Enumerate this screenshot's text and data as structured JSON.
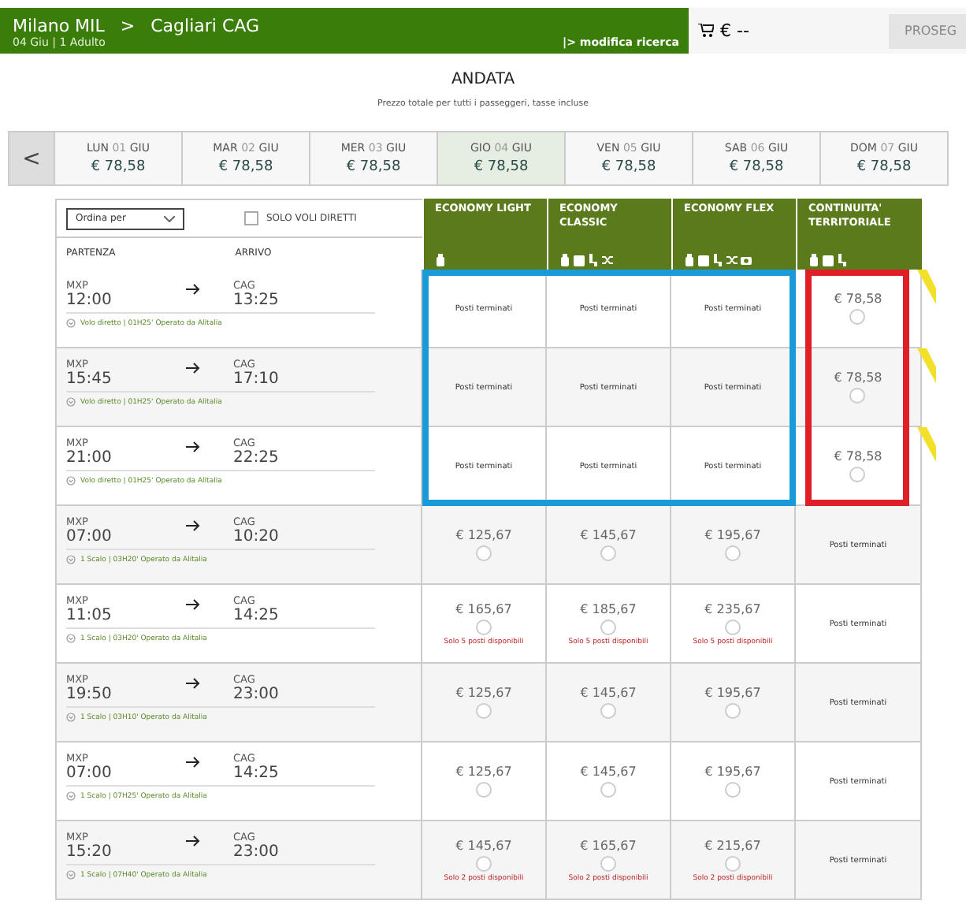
{
  "header": {
    "origin": "Milano MIL",
    "separator": ">",
    "destination": "Cagliari CAG",
    "details": "04 Giu | 1 Adulto",
    "modify_link": "|> modifica ricerca",
    "cart_total": "€ --",
    "continue_button": "PROSEG"
  },
  "title": "ANDATA",
  "subtitle": "Prezzo totale per tutti i passeggeri, tasse incluse",
  "date_strip": {
    "prev_button": "<",
    "days": [
      {
        "weekday": "LUN",
        "day": "01",
        "month": "GIU",
        "price": "€ 78,58",
        "selected": false
      },
      {
        "weekday": "MAR",
        "day": "02",
        "month": "GIU",
        "price": "€ 78,58",
        "selected": false
      },
      {
        "weekday": "MER",
        "day": "03",
        "month": "GIU",
        "price": "€ 78,58",
        "selected": false
      },
      {
        "weekday": "GIO",
        "day": "04",
        "month": "GIU",
        "price": "€ 78,58",
        "selected": true
      },
      {
        "weekday": "VEN",
        "day": "05",
        "month": "GIU",
        "price": "€ 78,58",
        "selected": false
      },
      {
        "weekday": "SAB",
        "day": "06",
        "month": "GIU",
        "price": "€ 78,58",
        "selected": false
      },
      {
        "weekday": "DOM",
        "day": "07",
        "month": "GIU",
        "price": "€ 78,58",
        "selected": false
      }
    ]
  },
  "table": {
    "sort_select": "Ordina per",
    "direct_only": {
      "label": "SOLO VOLI DIRETTI",
      "checked": false
    },
    "departure_heading": "PARTENZA",
    "arrival_heading": "ARRIVO",
    "fares": [
      {
        "name": "ECONOMY LIGHT"
      },
      {
        "name": "ECONOMY CLASSIC"
      },
      {
        "name": "ECONOMY FLEX"
      },
      {
        "name": "CONTINUITA' TERRITORIALE"
      }
    ],
    "rows": [
      {
        "from": "MXP",
        "dep": "12:00",
        "to": "CAG",
        "arr": "13:25",
        "info": "Volo diretto | 01H25' Operato da Alitalia",
        "cells": [
          {
            "kind": "soldout",
            "text": "Posti terminati"
          },
          {
            "kind": "soldout",
            "text": "Posti terminati"
          },
          {
            "kind": "soldout",
            "text": "Posti terminati"
          },
          {
            "kind": "price",
            "price": "€ 78,58",
            "selected": false,
            "flag": true
          }
        ]
      },
      {
        "from": "MXP",
        "dep": "15:45",
        "to": "CAG",
        "arr": "17:10",
        "info": "Volo diretto | 01H25' Operato da Alitalia",
        "cells": [
          {
            "kind": "soldout",
            "text": "Posti terminati"
          },
          {
            "kind": "soldout",
            "text": "Posti terminati"
          },
          {
            "kind": "soldout",
            "text": "Posti terminati"
          },
          {
            "kind": "price",
            "price": "€ 78,58",
            "selected": false,
            "flag": true
          }
        ]
      },
      {
        "from": "MXP",
        "dep": "21:00",
        "to": "CAG",
        "arr": "22:25",
        "info": "Volo diretto | 01H25' Operato da Alitalia",
        "cells": [
          {
            "kind": "soldout",
            "text": "Posti terminati"
          },
          {
            "kind": "soldout",
            "text": "Posti terminati"
          },
          {
            "kind": "soldout",
            "text": "Posti terminati"
          },
          {
            "kind": "price",
            "price": "€ 78,58",
            "selected": false,
            "flag": true
          }
        ]
      },
      {
        "from": "MXP",
        "dep": "07:00",
        "to": "CAG",
        "arr": "10:20",
        "info": "1 Scalo | 03H20' Operato da Alitalia",
        "cells": [
          {
            "kind": "price",
            "price": "€ 125,67",
            "selected": false
          },
          {
            "kind": "price",
            "price": "€ 145,67",
            "selected": false
          },
          {
            "kind": "price",
            "price": "€ 195,67",
            "selected": false
          },
          {
            "kind": "soldout",
            "text": "Posti terminati"
          }
        ]
      },
      {
        "from": "MXP",
        "dep": "11:05",
        "to": "CAG",
        "arr": "14:25",
        "info": "1 Scalo | 03H20' Operato da Alitalia",
        "cells": [
          {
            "kind": "price",
            "price": "€ 165,67",
            "selected": false,
            "note": "Solo 5 posti disponibili"
          },
          {
            "kind": "price",
            "price": "€ 185,67",
            "selected": false,
            "note": "Solo 5 posti disponibili"
          },
          {
            "kind": "price",
            "price": "€ 235,67",
            "selected": false,
            "note": "Solo 5 posti disponibili"
          },
          {
            "kind": "soldout",
            "text": "Posti terminati"
          }
        ]
      },
      {
        "from": "MXP",
        "dep": "19:50",
        "to": "CAG",
        "arr": "23:00",
        "info": "1 Scalo | 03H10' Operato da Alitalia",
        "cells": [
          {
            "kind": "price",
            "price": "€ 125,67",
            "selected": false
          },
          {
            "kind": "price",
            "price": "€ 145,67",
            "selected": false
          },
          {
            "kind": "price",
            "price": "€ 195,67",
            "selected": false
          },
          {
            "kind": "soldout",
            "text": "Posti terminati"
          }
        ]
      },
      {
        "from": "MXP",
        "dep": "07:00",
        "to": "CAG",
        "arr": "14:25",
        "info": "1 Scalo | 07H25' Operato da Alitalia",
        "cells": [
          {
            "kind": "price",
            "price": "€ 125,67",
            "selected": false
          },
          {
            "kind": "price",
            "price": "€ 145,67",
            "selected": false
          },
          {
            "kind": "price",
            "price": "€ 195,67",
            "selected": false
          },
          {
            "kind": "soldout",
            "text": "Posti terminati"
          }
        ]
      },
      {
        "from": "MXP",
        "dep": "15:20",
        "to": "CAG",
        "arr": "23:00",
        "info": "1 Scalo | 07H40' Operato da Alitalia",
        "cells": [
          {
            "kind": "price",
            "price": "€ 145,67",
            "selected": false,
            "note": "Solo 2 posti disponibili"
          },
          {
            "kind": "price",
            "price": "€ 165,67",
            "selected": false,
            "note": "Solo 2 posti disponibili"
          },
          {
            "kind": "price",
            "price": "€ 215,67",
            "selected": false,
            "note": "Solo 2 posti disponibili"
          },
          {
            "kind": "soldout",
            "text": "Posti terminati"
          }
        ]
      }
    ]
  },
  "highlights": [
    {
      "color": "#1a9ad6"
    },
    {
      "color": "#e11f26"
    }
  ]
}
